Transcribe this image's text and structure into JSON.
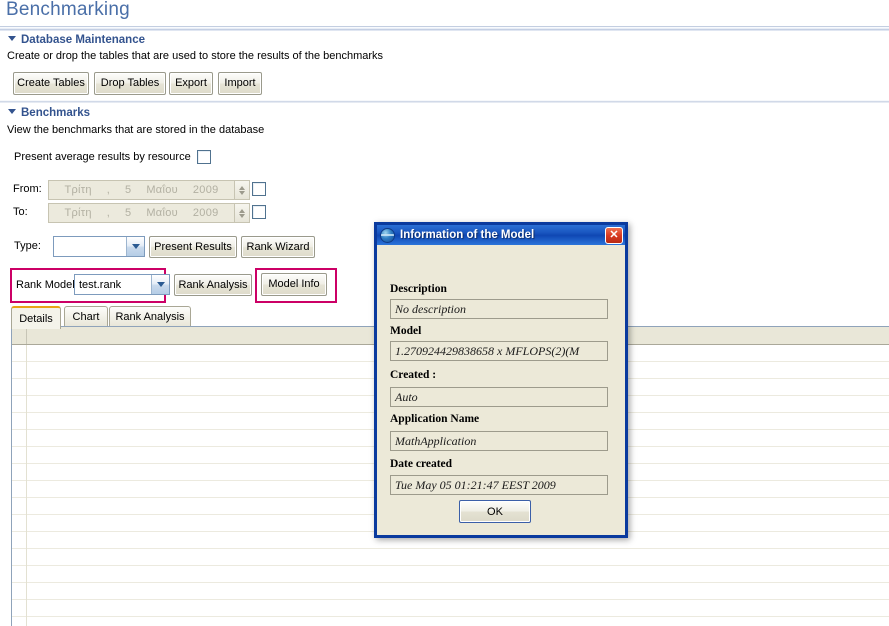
{
  "page": {
    "title": "Benchmarking"
  },
  "db_section": {
    "heading": "Database Maintenance",
    "description": "Create or drop the tables that are used to store the results of the benchmarks",
    "buttons": [
      {
        "label": "Create Tables"
      },
      {
        "label": "Drop Tables"
      },
      {
        "label": "Export"
      },
      {
        "label": "Import"
      }
    ]
  },
  "benchmarks_section": {
    "heading": "Benchmarks",
    "description": "View the benchmarks that are stored in the database",
    "average_label": "Present average results by resource",
    "from_label": "From:",
    "to_label": "To:",
    "date_from": {
      "weekday": "Τρίτη",
      "comma": ",",
      "day": "5",
      "month": "Μαΐου",
      "year": "2009"
    },
    "date_to": {
      "weekday": "Τρίτη",
      "comma": ",",
      "day": "5",
      "month": "Μαΐου",
      "year": "2009"
    },
    "type_label": "Type:",
    "type_value": "",
    "present_results_label": "Present Results",
    "rank_wizard_label": "Rank Wizard",
    "rank_model_label": "Rank Model",
    "rank_model_value": "test.rank",
    "rank_analysis_label": "Rank Analysis",
    "model_info_label": "Model Info"
  },
  "tabs": [
    {
      "label": "Details",
      "active": true
    },
    {
      "label": "Chart",
      "active": false
    },
    {
      "label": "Rank Analysis",
      "active": false
    }
  ],
  "dialog": {
    "title": "Information of the Model",
    "close_label": "✕",
    "fields": [
      {
        "label": "Description",
        "value": "No description"
      },
      {
        "label": "Model",
        "value": "1.270924429838658 x MFLOPS(2)(M"
      },
      {
        "label": "Created :",
        "value": "Auto"
      },
      {
        "label": "Application Name",
        "value": "MathApplication"
      },
      {
        "label": "Date created",
        "value": "Tue May 05 01:21:47 EEST 2009"
      }
    ],
    "ok_label": "OK"
  },
  "colors": {
    "title_blue": "#4a6fa8",
    "section_blue": "#33538e",
    "annotation_pink": "#cc0066",
    "dialog_border": "#0a3a9e",
    "tab_active_accent": "#e8a317"
  }
}
